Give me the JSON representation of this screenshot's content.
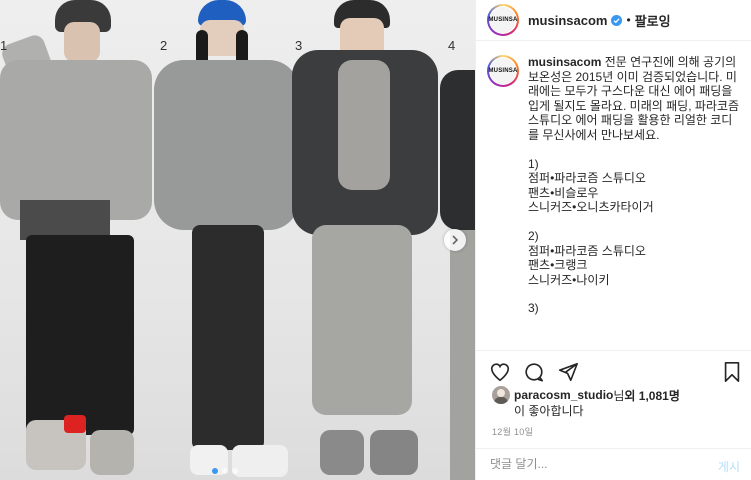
{
  "photo": {
    "labels": [
      "1",
      "2",
      "3",
      "4"
    ],
    "carousel_count": 3,
    "carousel_active": 0
  },
  "header": {
    "avatar_text": "MUSINSA",
    "username": "musinsacom",
    "separator": "•",
    "follow": "팔로잉"
  },
  "caption": {
    "username": "musinsacom",
    "text": "전문 연구진에 의해 공기의 보온성은 2015년 이미 검증되었습니다. 미래에는 모두가 구스다운 대신 에어 패딩을 입게 될지도 몰라요. 미래의 패딩, 파라코즘 스튜디오 에어 패딩을 활용한 리얼한 코디를 무신사에서 만나보세요.",
    "items": [
      [
        "1)",
        "점퍼•파라코즘 스튜디오",
        "팬츠•비슬로우",
        "스니커즈•오니츠카타이거"
      ],
      [
        "2)",
        "점퍼•파라코즘 스튜디오",
        "팬츠•크랭크",
        "스니커즈•나이키"
      ],
      [
        "3)"
      ]
    ]
  },
  "likes": {
    "user": "paracosm_studio",
    "text_mid": "님 ",
    "text_bold": "외 1,081명",
    "line2": "이 좋아합니다"
  },
  "date": "12월 10일",
  "comment": {
    "placeholder": "댓글 달기...",
    "post": "게시"
  },
  "colors": {
    "verified": "#3897f0",
    "post_disabled": "#b2dffc"
  }
}
